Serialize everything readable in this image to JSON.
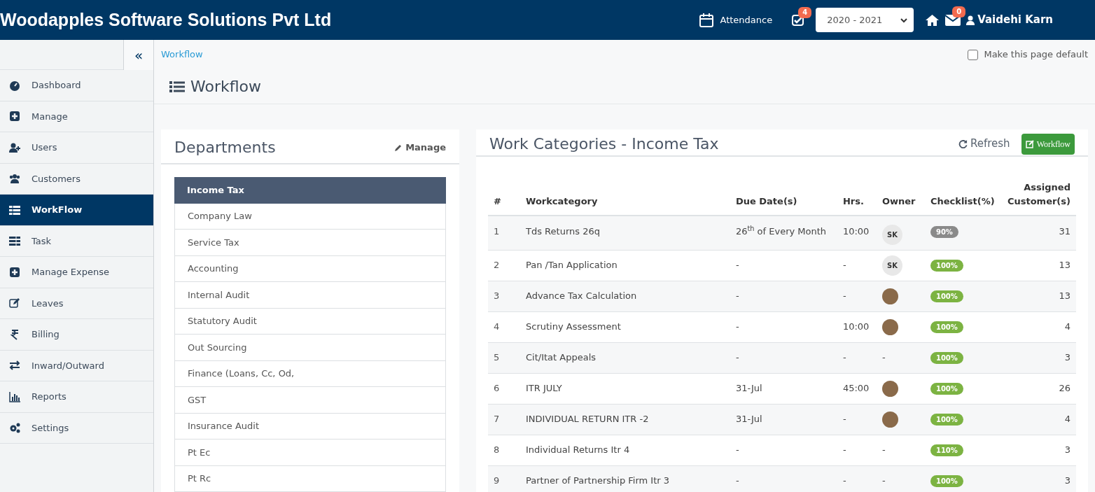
{
  "header": {
    "title": "Woodapples Software Solutions Pvt Ltd",
    "attendance": "Attendance",
    "tasks_badge": "4",
    "year_select": "2020 - 2021",
    "mail_badge": "0",
    "user": "Vaidehi Karn"
  },
  "sidebar": {
    "collapse": "«",
    "items": [
      {
        "label": "Dashboard",
        "kind": "dashboard",
        "selected": false
      },
      {
        "label": "Manage",
        "kind": "plus",
        "selected": false
      },
      {
        "label": "Users",
        "kind": "user-plus",
        "selected": false
      },
      {
        "label": "Customers",
        "kind": "users",
        "selected": false
      },
      {
        "label": "WorkFlow",
        "kind": "list",
        "selected": true
      },
      {
        "label": "Task",
        "kind": "tasks",
        "selected": false
      },
      {
        "label": "Manage Expense",
        "kind": "plus",
        "selected": false
      },
      {
        "label": "Leaves",
        "kind": "edit",
        "selected": false
      },
      {
        "label": "Billing",
        "kind": "rupee",
        "selected": false
      },
      {
        "label": "Inward/Outward",
        "kind": "exchange",
        "selected": false
      },
      {
        "label": "Reports",
        "kind": "chart",
        "selected": false
      },
      {
        "label": "Settings",
        "kind": "gears",
        "selected": false
      }
    ]
  },
  "breadcrumb": "Workflow",
  "default_checkbox": {
    "label": "Make this page default",
    "checked": false
  },
  "page_title": "Workflow",
  "departments": {
    "title": "Departments",
    "manage": "Manage",
    "items": [
      {
        "label": "Income Tax",
        "selected": true
      },
      {
        "label": "Company Law",
        "selected": false
      },
      {
        "label": "Service Tax",
        "selected": false
      },
      {
        "label": "Accounting",
        "selected": false
      },
      {
        "label": "Internal Audit",
        "selected": false
      },
      {
        "label": "Statutory Audit",
        "selected": false
      },
      {
        "label": "Out Sourcing",
        "selected": false
      },
      {
        "label": "Finance (Loans, Cc, Od,",
        "selected": false
      },
      {
        "label": "GST",
        "selected": false
      },
      {
        "label": "Insurance Audit",
        "selected": false
      },
      {
        "label": "Pt Ec",
        "selected": false
      },
      {
        "label": "Pt Rc",
        "selected": false
      }
    ]
  },
  "work_categories": {
    "title": "Work Categories - Income Tax",
    "refresh": "Refresh",
    "workflow_button": "Workflow",
    "columns": [
      "#",
      "Workcategory",
      "Due Date(s)",
      "Hrs.",
      "Owner",
      "Checklist(%)",
      "Assigned Customer(s)"
    ],
    "rows": [
      {
        "n": "1",
        "name": "Tds Returns 26q",
        "due": "26$^{th}$ of Every Month",
        "hrs": "10:00",
        "owner": {
          "kind": "initials",
          "text": "SK"
        },
        "checklist": "90%",
        "color": "#8a8a8a",
        "assigned": "31"
      },
      {
        "n": "2",
        "name": "Pan /Tan Application",
        "due": "-",
        "hrs": "-",
        "owner": {
          "kind": "initials",
          "text": "SK"
        },
        "checklist": "100%",
        "color": "#7cb342",
        "assigned": "13"
      },
      {
        "n": "3",
        "name": "Advance Tax Calculation",
        "due": "-",
        "hrs": "-",
        "owner": {
          "kind": "photo"
        },
        "checklist": "100%",
        "color": "#7cb342",
        "assigned": "13"
      },
      {
        "n": "4",
        "name": "Scrutiny Assessment",
        "due": "-",
        "hrs": "10:00",
        "owner": {
          "kind": "photo"
        },
        "checklist": "100%",
        "color": "#7cb342",
        "assigned": "4"
      },
      {
        "n": "5",
        "name": "Cit/Itat Appeals",
        "due": "-",
        "hrs": "-",
        "owner": {
          "kind": "text",
          "text": "-"
        },
        "checklist": "100%",
        "color": "#7cb342",
        "assigned": "3"
      },
      {
        "n": "6",
        "name": "ITR JULY",
        "due": "31-Jul",
        "hrs": "45:00",
        "owner": {
          "kind": "photo"
        },
        "checklist": "100%",
        "color": "#7cb342",
        "assigned": "26"
      },
      {
        "n": "7",
        "name": "INDIVIDUAL RETURN ITR -2",
        "due": "31-Jul",
        "hrs": "-",
        "owner": {
          "kind": "photo"
        },
        "checklist": "100%",
        "color": "#7cb342",
        "assigned": "4"
      },
      {
        "n": "8",
        "name": "Individual Returns Itr 4",
        "due": "-",
        "hrs": "-",
        "owner": {
          "kind": "text",
          "text": "-"
        },
        "checklist": "110%",
        "color": "#7cb342",
        "assigned": "3"
      },
      {
        "n": "9",
        "name": "Partner of Partnership Firm Itr 3",
        "due": "-",
        "hrs": "-",
        "owner": {
          "kind": "text",
          "text": "-"
        },
        "checklist": "100%",
        "color": "#7cb342",
        "assigned": "3"
      }
    ]
  }
}
